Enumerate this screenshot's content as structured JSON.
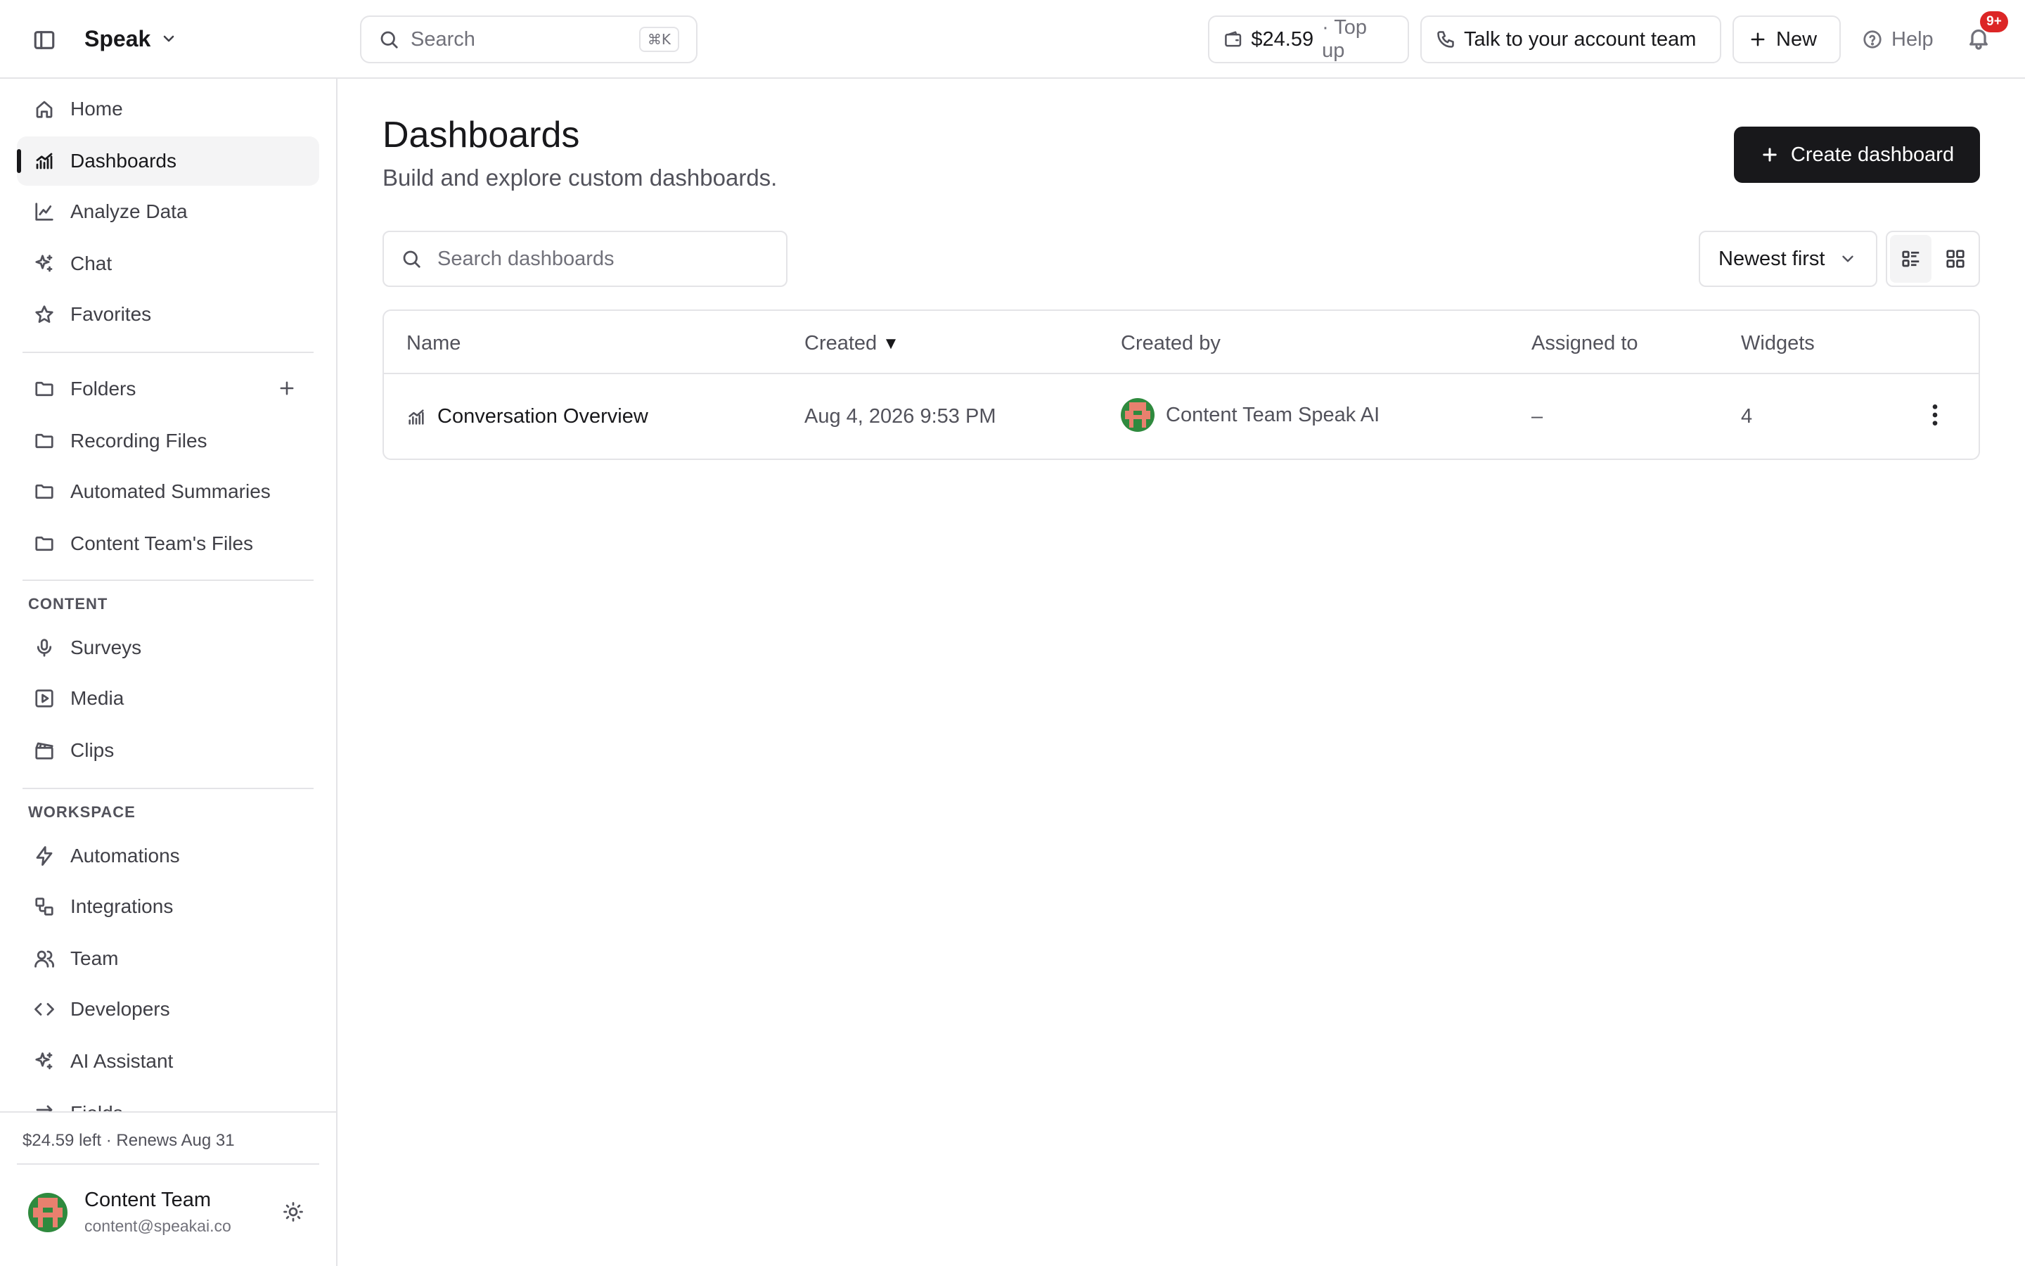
{
  "topbar": {
    "brand": "Speak",
    "search_placeholder": "Search",
    "search_shortcut": "⌘K",
    "balance_amount": "$24.59",
    "balance_action": "· Top up",
    "account_team_label": "Talk to your account team",
    "new_label": "New",
    "help_label": "Help",
    "notifications_badge": "9+"
  },
  "sidebar": {
    "nav": [
      {
        "label": "Home",
        "icon": "home-icon"
      },
      {
        "label": "Dashboards",
        "icon": "dashboard-chart-icon",
        "active": true
      },
      {
        "label": "Analyze Data",
        "icon": "line-chart-icon"
      },
      {
        "label": "Chat",
        "icon": "sparkles-icon"
      },
      {
        "label": "Favorites",
        "icon": "star-icon"
      }
    ],
    "folders_label": "Folders",
    "folders": [
      {
        "label": "Recording Files"
      },
      {
        "label": "Automated Summaries"
      },
      {
        "label": "Content Team's Files"
      }
    ],
    "content_section": "CONTENT",
    "content": [
      {
        "label": "Surveys",
        "icon": "microphone-icon"
      },
      {
        "label": "Media",
        "icon": "play-square-icon"
      },
      {
        "label": "Clips",
        "icon": "clapperboard-icon"
      }
    ],
    "workspace_section": "WORKSPACE",
    "workspace": [
      {
        "label": "Automations",
        "icon": "lightning-icon"
      },
      {
        "label": "Integrations",
        "icon": "integrations-icon"
      },
      {
        "label": "Team",
        "icon": "users-icon"
      },
      {
        "label": "Developers",
        "icon": "code-icon"
      },
      {
        "label": "AI Assistant",
        "icon": "sparkles-icon"
      },
      {
        "label": "Fields",
        "icon": "fields-icon"
      }
    ],
    "plan_status": "$24.59 left · Renews Aug 31",
    "user": {
      "name": "Content Team",
      "email": "content@speakai.co"
    }
  },
  "main": {
    "title": "Dashboards",
    "subtitle": "Build and explore custom dashboards.",
    "create_label": "Create dashboard",
    "search_placeholder": "Search dashboards",
    "sort_label": "Newest first",
    "table": {
      "headers": {
        "name": "Name",
        "created": "Created",
        "created_sort_indicator": "▼",
        "created_by": "Created by",
        "assigned_to": "Assigned to",
        "widgets": "Widgets"
      },
      "rows": [
        {
          "name": "Conversation Overview",
          "created": "Aug 4, 2026 9:53 PM",
          "created_by": "Content Team Speak AI",
          "assigned_to": "–",
          "widgets": "4"
        }
      ]
    }
  },
  "colors": {
    "primary_button": "#18181b",
    "badge": "#dc2626",
    "avatar_green": "#2f8a3e",
    "avatar_coral": "#e9806e"
  }
}
